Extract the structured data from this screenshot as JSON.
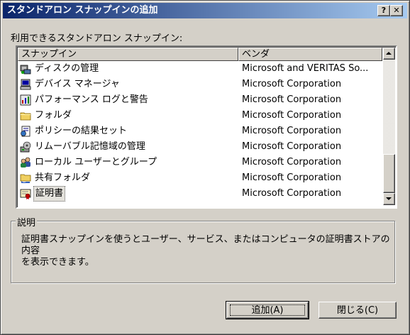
{
  "window": {
    "title": "スタンドアロン スナップインの追加",
    "help_button": "?",
    "close_button": "✕"
  },
  "list": {
    "caption": "利用できるスタンドアロン スナップイン:",
    "columns": [
      "スナップイン",
      "ベンダ"
    ],
    "items": [
      {
        "name": "ディスクの管理",
        "vendor": "Microsoft and VERITAS So...",
        "icon": "disk-management-icon"
      },
      {
        "name": "デバイス マネージャ",
        "vendor": "Microsoft Corporation",
        "icon": "device-manager-icon"
      },
      {
        "name": "パフォーマンス ログと警告",
        "vendor": "Microsoft Corporation",
        "icon": "performance-logs-icon"
      },
      {
        "name": "フォルダ",
        "vendor": "Microsoft Corporation",
        "icon": "folder-icon"
      },
      {
        "name": "ポリシーの結果セット",
        "vendor": "Microsoft Corporation",
        "icon": "policy-results-icon"
      },
      {
        "name": "リムーバブル記憶域の管理",
        "vendor": "Microsoft Corporation",
        "icon": "removable-storage-icon"
      },
      {
        "name": "ローカル ユーザーとグループ",
        "vendor": "Microsoft Corporation",
        "icon": "local-users-icon"
      },
      {
        "name": "共有フォルダ",
        "vendor": "Microsoft Corporation",
        "icon": "shared-folder-icon"
      },
      {
        "name": "証明書",
        "vendor": "Microsoft Corporation",
        "icon": "certificate-icon",
        "selected": true
      }
    ]
  },
  "description": {
    "label": "説明",
    "text": "証明書スナップインを使うとユーザー、サービス、またはコンピュータの証明書ストアの内容\nを表示できます。"
  },
  "buttons": {
    "add": "追加(A)",
    "close": "閉じる(C)"
  },
  "colors": {
    "title_start": "#0a246a",
    "title_end": "#a6caf0",
    "face": "#d4d0c8"
  }
}
